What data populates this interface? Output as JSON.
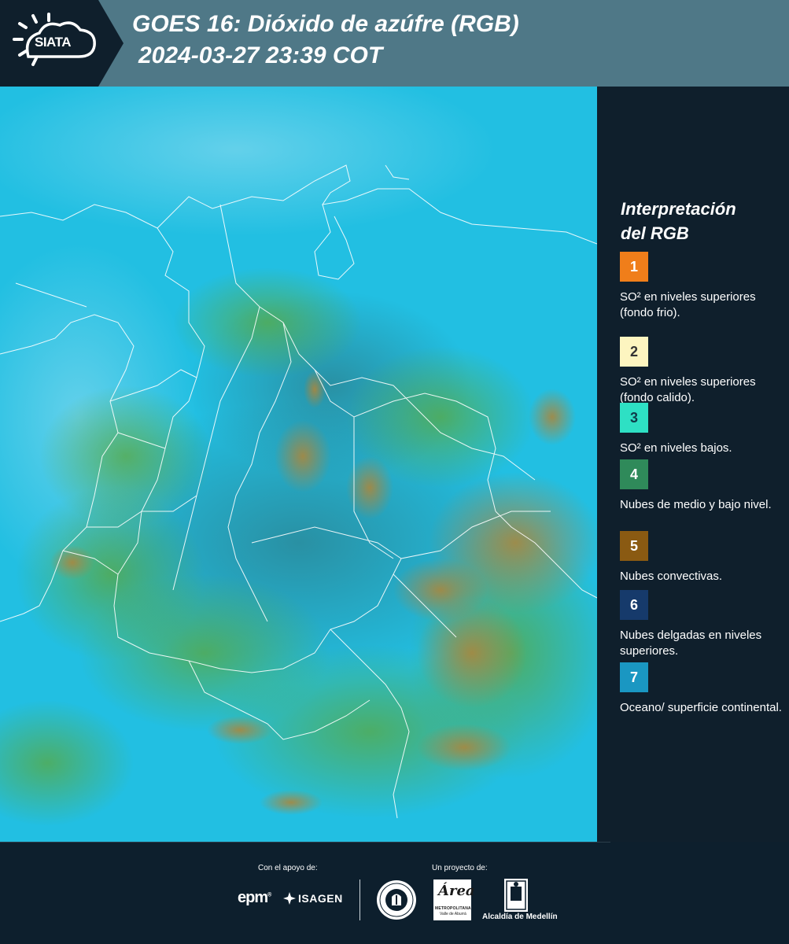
{
  "header": {
    "logo_text": "SIATA",
    "title_line1": "GOES 16: Dióxido de azúfre (RGB)",
    "title_line2": "2024-03-27 23:39 COT",
    "background_color": "#4f7887",
    "logo_background_color": "#0f1f2c"
  },
  "legend": {
    "title_line1": "Interpretación",
    "title_line2": "del RGB",
    "items": [
      {
        "number": "1",
        "label": "SO² en niveles superiores (fondo frio).",
        "color": "#f07e1a",
        "text_color": "#ffffff"
      },
      {
        "number": "2",
        "label": "SO² en niveles superiores (fondo calido).",
        "color": "#fdf5c0",
        "text_color": "#333333"
      },
      {
        "number": "3",
        "label": "SO² en niveles bajos.",
        "color": "#2ee0c4",
        "text_color": "#0f3b4a"
      },
      {
        "number": "4",
        "label": "Nubes de medio y bajo nivel.",
        "color": "#2f8a5a",
        "text_color": "#ffffff"
      },
      {
        "number": "5",
        "label": "Nubes convectivas.",
        "color": "#8a5a12",
        "text_color": "#ffffff"
      },
      {
        "number": "6",
        "label": "Nubes delgadas en niveles superiores.",
        "color": "#163a6b",
        "text_color": "#ffffff"
      },
      {
        "number": "7",
        "label": "Oceano/ superficie continental.",
        "color": "#1a97c2",
        "text_color": "#ffffff"
      }
    ]
  },
  "map": {
    "description_colors": {
      "background": "#1ec3e6",
      "convective": "#b5873a",
      "green": "#4caa3c",
      "border_lines": "#ffffff"
    }
  },
  "footer": {
    "support_label": "Con el apoyo de:",
    "project_label": "Un proyecto de:",
    "epm": "epm",
    "isagen": "ISAGEN",
    "area_script": "Área",
    "area_sub": "METROPOLITANA",
    "area_sub2": "Valle de Aburrá",
    "alcaldia": "Alcaldía de Medellín"
  }
}
